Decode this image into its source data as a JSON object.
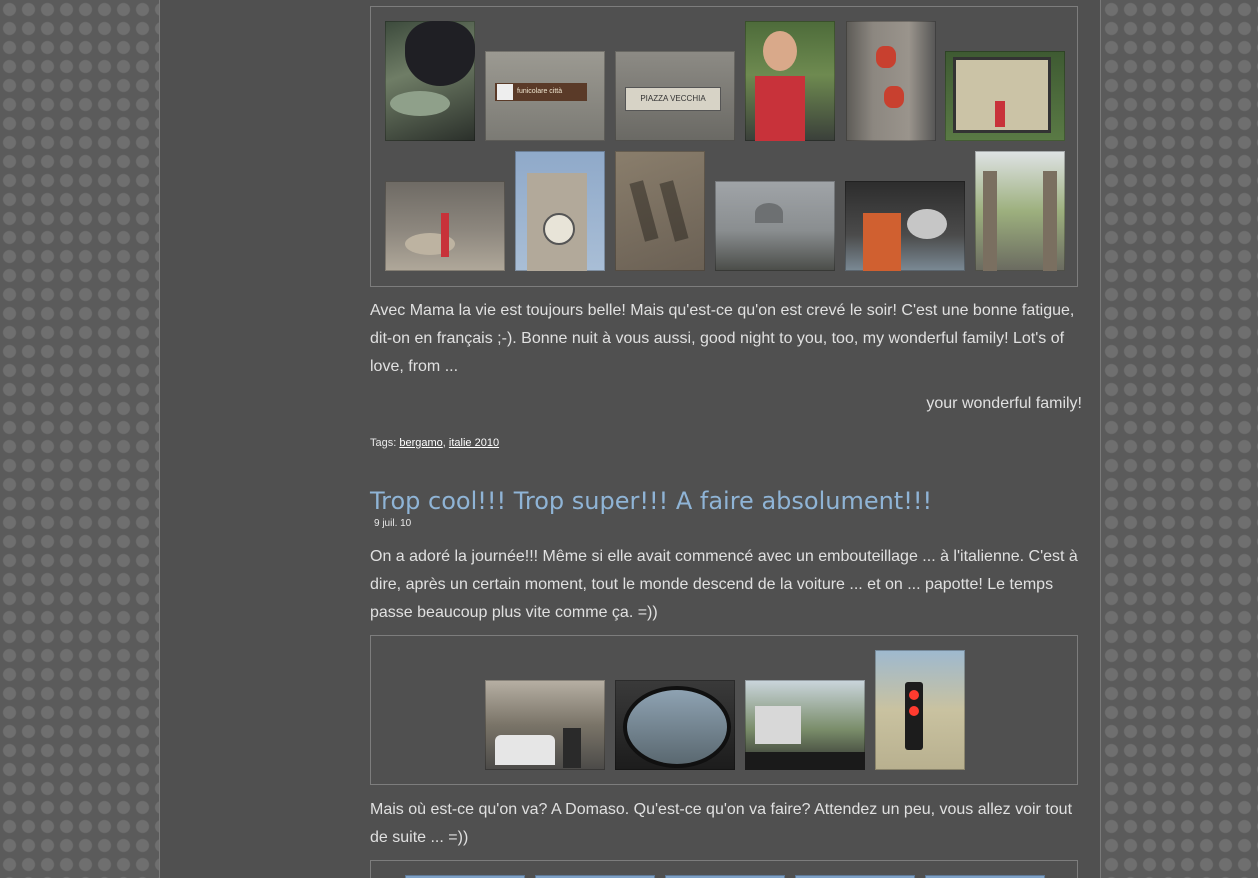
{
  "post1": {
    "paragraph": "Avec Mama la vie est toujours belle! Mais qu'est-ce qu'on est crevé le soir! C'est une bonne fatigue, dit-on en français ;-). Bonne nuit à vous aussi, good night to you, too, my wonderful family! Lot's of love, from ...",
    "signature": "your wonderful family!",
    "tags_label": "Tags:",
    "tags": [
      "bergamo",
      "italie 2010"
    ],
    "tag_separator": ",",
    "photo_signs": {
      "funicolare": "funicolare città",
      "piazza": "PIAZZA VECCHIA"
    }
  },
  "post2": {
    "title": "Trop cool!!! Trop super!!! A faire absolument!!!",
    "date": "9 juil. 10",
    "paragraph1": "On a adoré la journée!!! Même si elle avait commencé avec un embouteillage ... à l'italienne. C'est à dire, après un certain moment, tout le monde descend de la voiture ... et on ... papotte! Le temps passe beaucoup plus vite comme ça. =))",
    "paragraph2": "Mais où est-ce qu'on va? A Domaso. Qu'est-ce qu'on va faire? Attendez un peu, vous allez voir tout de suite ... =))"
  },
  "colors": {
    "page_bg": "#505050",
    "outer_bg": "#5b5b5b",
    "title": "#8fb4d6",
    "text": "#e0e0e0"
  }
}
